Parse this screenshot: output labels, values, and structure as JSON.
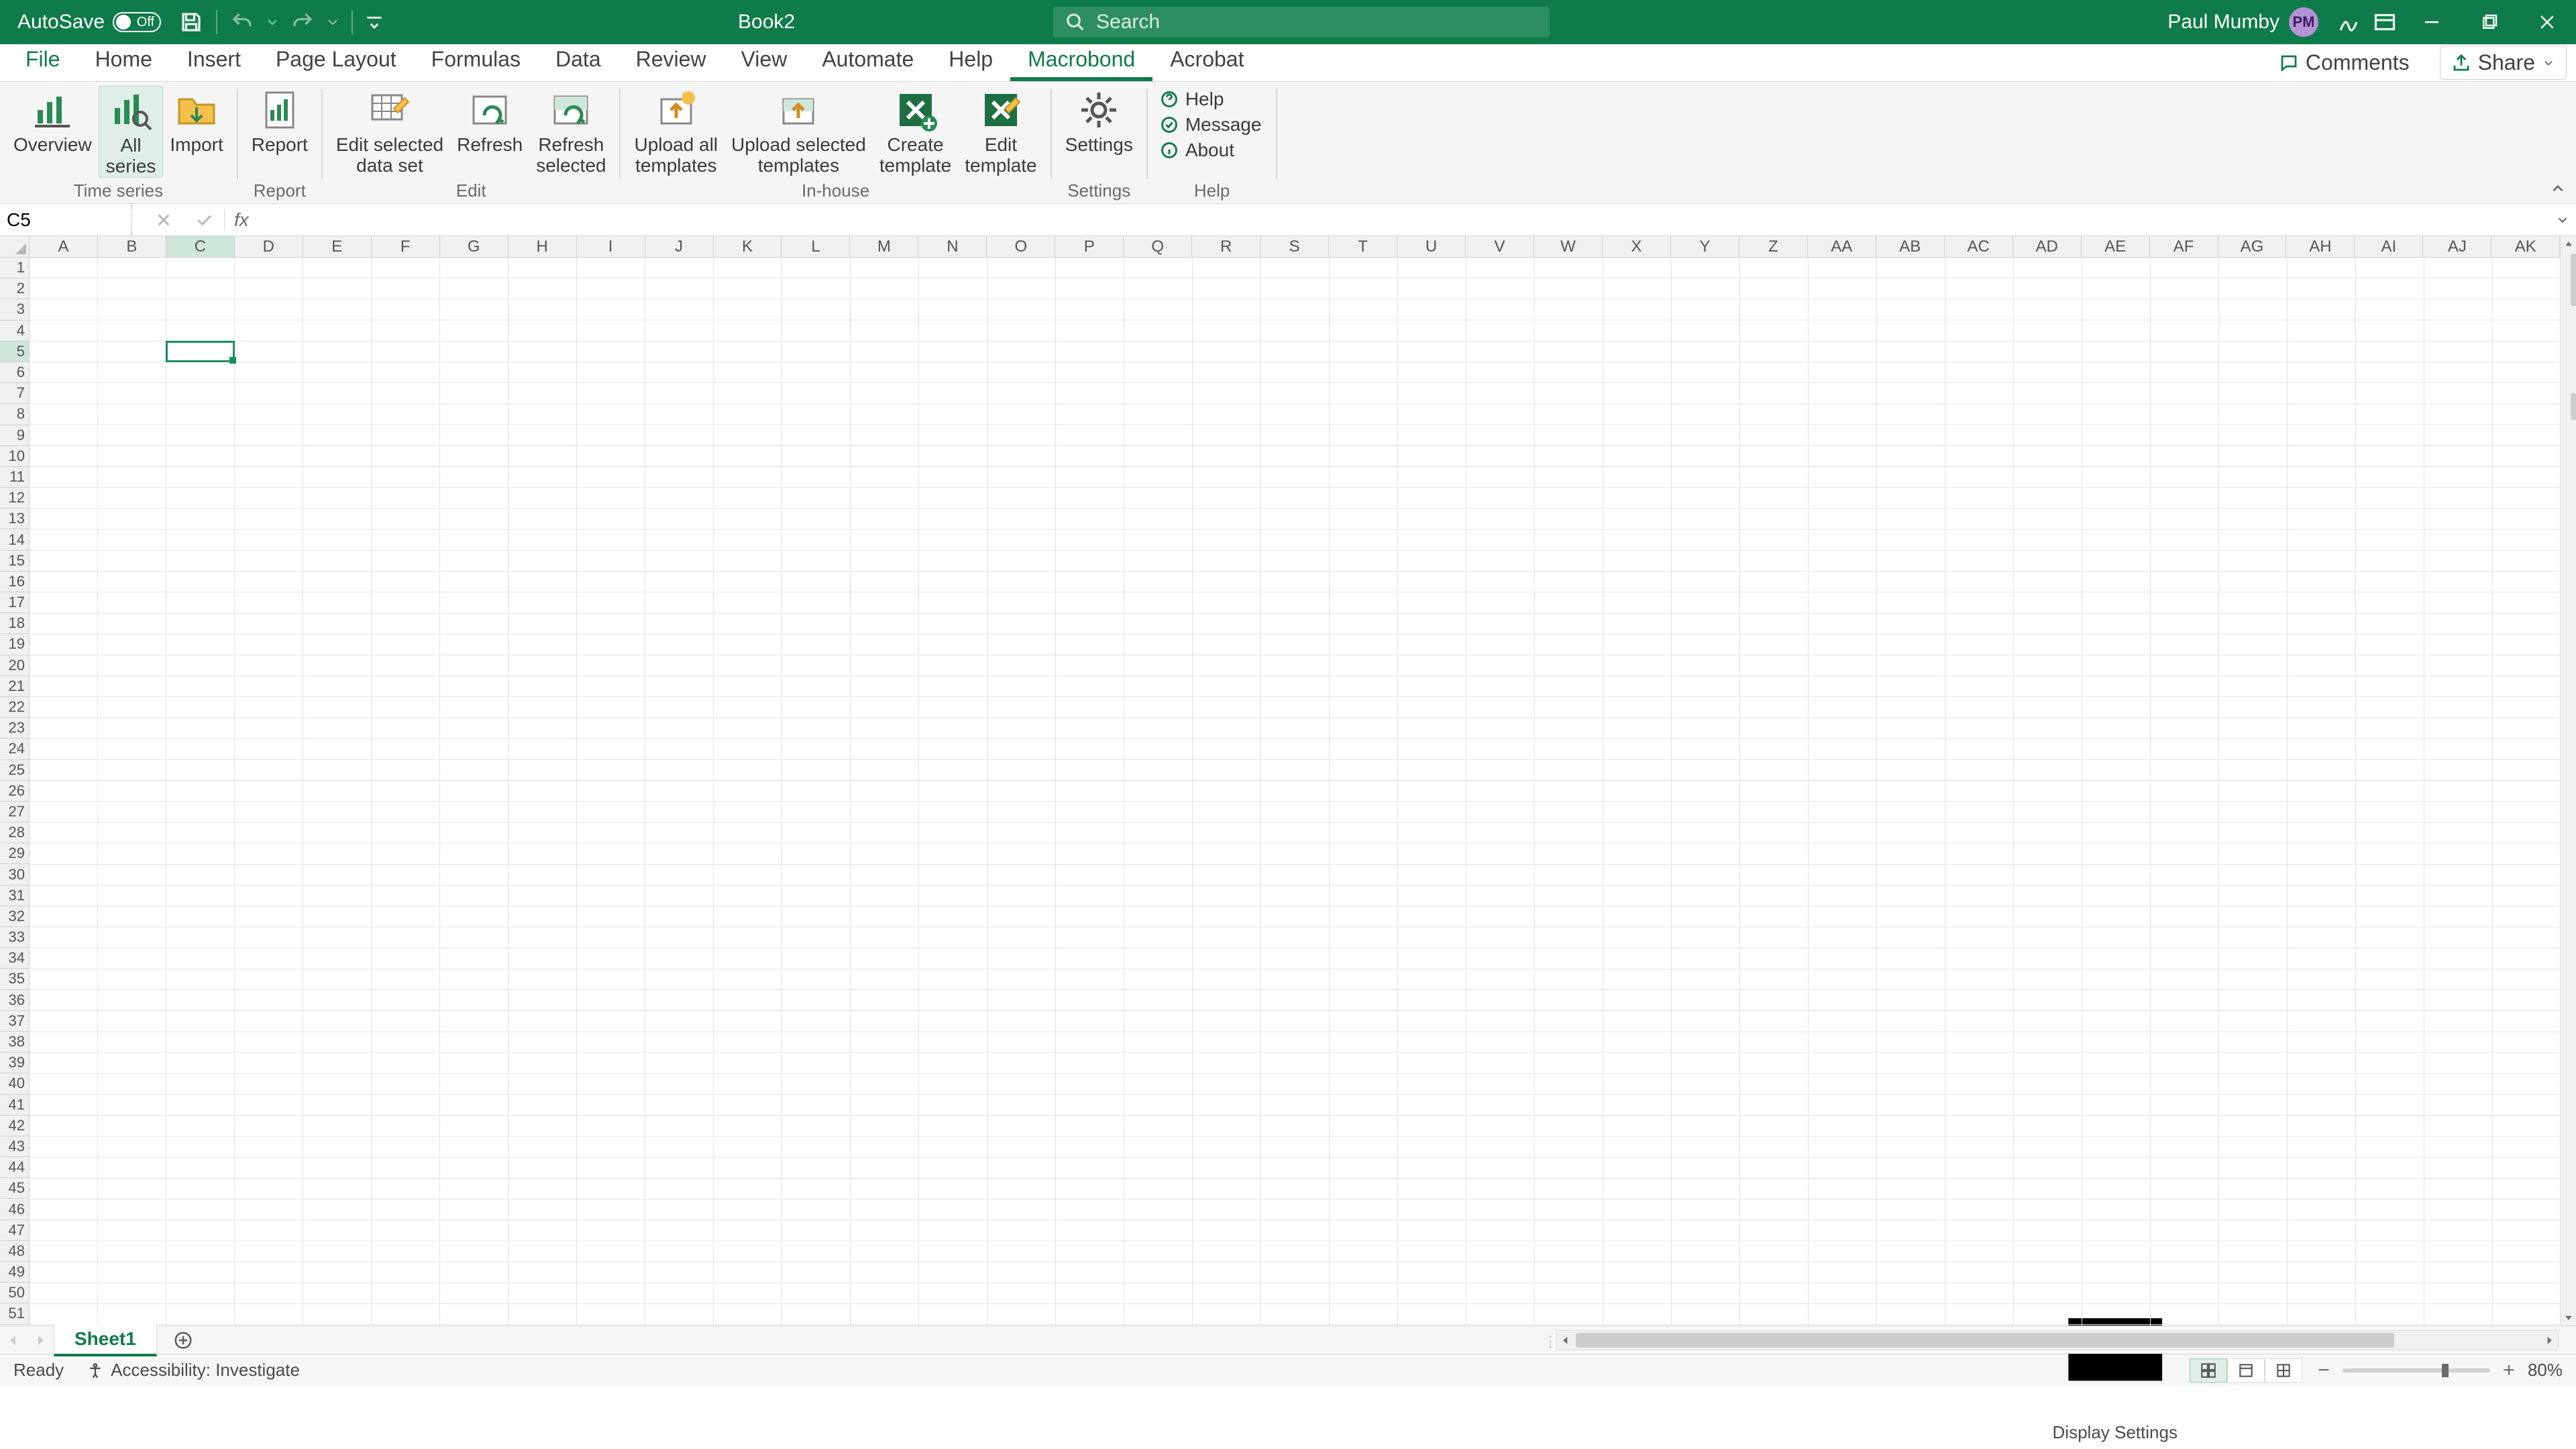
{
  "titlebar": {
    "autosave_label": "AutoSave",
    "autosave_state": "Off",
    "document_title": "Book2",
    "search_placeholder": "Search",
    "user_name": "Paul Mumby",
    "user_initials": "PM"
  },
  "tabs": {
    "items": [
      "File",
      "Home",
      "Insert",
      "Page Layout",
      "Formulas",
      "Data",
      "Review",
      "View",
      "Automate",
      "Help",
      "Macrobond",
      "Acrobat"
    ],
    "active": "Macrobond",
    "comments_label": "Comments",
    "share_label": "Share"
  },
  "ribbon": {
    "groups": [
      {
        "label": "Time series",
        "buttons": [
          {
            "id": "overview",
            "label": "Overview"
          },
          {
            "id": "all-series",
            "label": "All\nseries",
            "active": true
          },
          {
            "id": "import",
            "label": "Import"
          }
        ]
      },
      {
        "label": "Report",
        "buttons": [
          {
            "id": "report",
            "label": "Report"
          }
        ]
      },
      {
        "label": "Edit",
        "buttons": [
          {
            "id": "edit-selected-dataset",
            "label": "Edit selected\ndata set"
          },
          {
            "id": "refresh",
            "label": "Refresh"
          },
          {
            "id": "refresh-selected",
            "label": "Refresh\nselected"
          }
        ]
      },
      {
        "label": "In-house",
        "buttons": [
          {
            "id": "upload-all-templates",
            "label": "Upload all\ntemplates"
          },
          {
            "id": "upload-selected-templates",
            "label": "Upload selected\ntemplates"
          },
          {
            "id": "create-template",
            "label": "Create\ntemplate"
          },
          {
            "id": "edit-template",
            "label": "Edit\ntemplate"
          }
        ]
      },
      {
        "label": "Settings",
        "buttons": [
          {
            "id": "settings",
            "label": "Settings"
          }
        ]
      },
      {
        "label": "Help",
        "mini": [
          {
            "id": "help",
            "label": "Help"
          },
          {
            "id": "message",
            "label": "Message"
          },
          {
            "id": "about",
            "label": "About"
          }
        ]
      }
    ]
  },
  "formula_bar": {
    "name_box": "C5",
    "fx_label": "fx",
    "formula_value": ""
  },
  "grid": {
    "columns": [
      "A",
      "B",
      "C",
      "D",
      "E",
      "F",
      "G",
      "H",
      "I",
      "J",
      "K",
      "L",
      "M",
      "N",
      "O",
      "P",
      "Q",
      "R",
      "S",
      "T",
      "U",
      "V",
      "W",
      "X",
      "Y",
      "Z",
      "AA",
      "AB",
      "AC",
      "AD",
      "AE",
      "AF",
      "AG",
      "AH",
      "AI",
      "AJ",
      "AK"
    ],
    "rows": 51,
    "selected_cell": "C5",
    "selected_col_index": 2,
    "selected_row_index": 4
  },
  "sheets": {
    "active": "Sheet1",
    "items": [
      "Sheet1"
    ]
  },
  "statusbar": {
    "ready": "Ready",
    "accessibility": "Accessibility: Investigate",
    "display_settings": "Display Settings",
    "zoom": "80%"
  }
}
